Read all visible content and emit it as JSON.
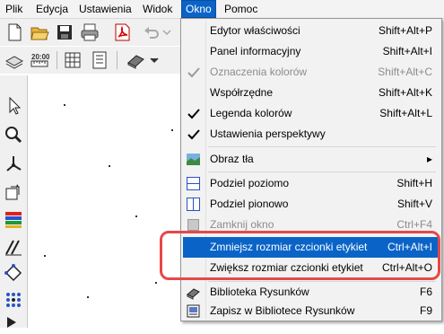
{
  "menubar": {
    "items": [
      {
        "label": "Plik"
      },
      {
        "label": "Edycja"
      },
      {
        "label": "Ustawienia"
      },
      {
        "label": "Widok"
      },
      {
        "label": "Okno"
      },
      {
        "label": "Pomoc"
      }
    ],
    "active_index": 4
  },
  "colors": {
    "highlight": "#0a64c8",
    "annotation_ring": "#e64848",
    "check_dark": "#000000",
    "check_disabled": "#9a9a9a"
  },
  "menu": {
    "items": [
      {
        "label": "Edytor właściwości",
        "shortcut": "Shift+Alt+P",
        "state": "normal"
      },
      {
        "label": "Panel informacyjny",
        "shortcut": "Shift+Alt+I",
        "state": "normal"
      },
      {
        "label": "Oznaczenia kolorów",
        "shortcut": "Shift+Alt+C",
        "state": "disabled",
        "checked": true
      },
      {
        "label": "Współrzędne",
        "shortcut": "Shift+Alt+K",
        "state": "normal"
      },
      {
        "label": "Legenda kolorów",
        "shortcut": "Shift+Alt+L",
        "state": "normal",
        "checked": true
      },
      {
        "label": "Ustawienia perspektywy",
        "shortcut": "",
        "state": "normal",
        "checked": true
      },
      {
        "label": "Obraz tła",
        "shortcut": "",
        "state": "normal",
        "submenu": true,
        "icon": "background-image-icon"
      },
      {
        "label": "Podziel poziomo",
        "shortcut": "Shift+H",
        "state": "normal",
        "icon": "split-horizontal-icon"
      },
      {
        "label": "Podziel pionowo",
        "shortcut": "Shift+V",
        "state": "normal",
        "icon": "split-vertical-icon"
      },
      {
        "label": "Zamknij okno",
        "shortcut": "Ctrl+F4",
        "state": "disabled",
        "icon": "close-window-icon"
      },
      {
        "label": "Zmniejsz rozmiar czcionki etykiet",
        "shortcut": "Ctrl+Alt+I",
        "state": "highlighted"
      },
      {
        "label": "Zwiększ rozmiar czcionki etykiet",
        "shortcut": "Ctrl+Alt+O",
        "state": "normal"
      },
      {
        "label": "Biblioteka Rysunków",
        "shortcut": "F6",
        "state": "normal",
        "icon": "library-icon"
      },
      {
        "label": "Zapisz w Bibliotece Rysunków",
        "shortcut": "F9",
        "state": "normal",
        "icon": "save-library-icon"
      }
    ],
    "submenu_arrow": "▸"
  },
  "toolbar": {
    "icons": [
      "new-file-icon",
      "open-folder-icon",
      "save-icon",
      "print-icon",
      "pdf-icon",
      "undo-icon",
      "chevron-down-icon",
      "layers-icon",
      "scale-icon",
      "grid-table-icon",
      "list-icon",
      "book-icon",
      "chevron-down-icon"
    ]
  },
  "leftbar": {
    "icons": [
      "pointer-icon",
      "zoom-icon",
      "axes-icon",
      "rotate-view-icon",
      "color-palette-icon",
      "measure-icon",
      "diamond-node-icon",
      "node-grid-icon",
      "arrow-icon"
    ]
  }
}
